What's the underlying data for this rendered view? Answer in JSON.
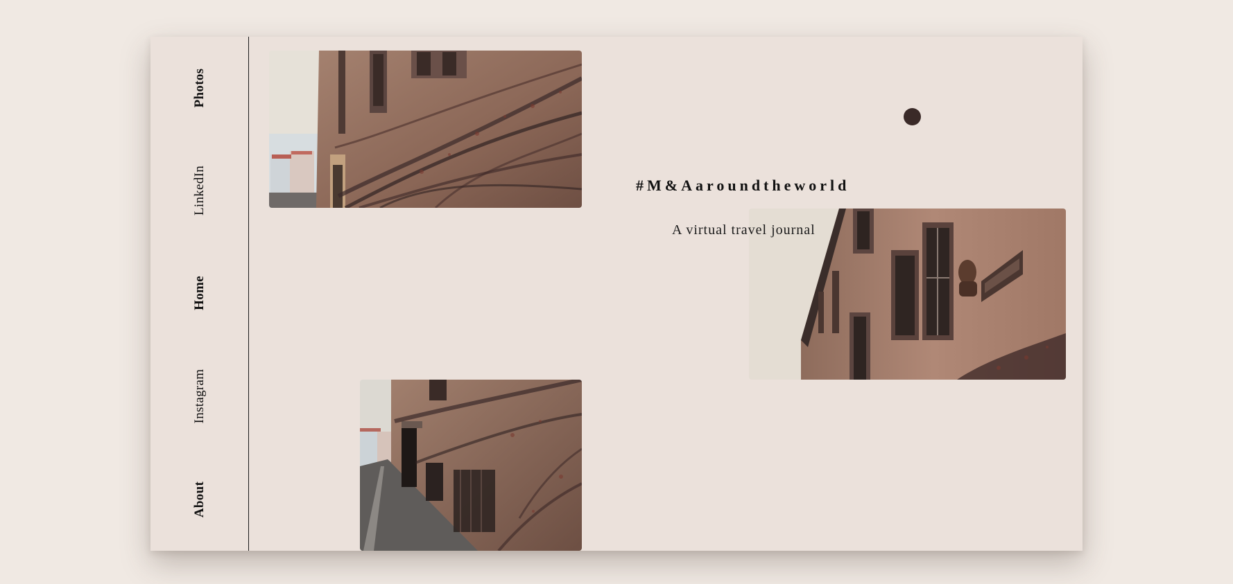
{
  "nav": {
    "photos": "Photos",
    "linkedin": "LinkedIn",
    "home": "Home",
    "instagram": "Instagram",
    "about": "About"
  },
  "hero": {
    "hashtag": "#M&Aaroundtheworld",
    "subtitle": "A virtual travel journal"
  },
  "photos": [
    {
      "subject": "ivy-covered building facade with street view"
    },
    {
      "subject": "building facade with bust and plaque"
    },
    {
      "subject": "cobblestone street along ivy-covered wall"
    }
  ],
  "colors": {
    "page_background": "#f0e9e3",
    "card_background": "#ebe1db",
    "accent_dot": "#3a2a28",
    "text": "#111111"
  }
}
